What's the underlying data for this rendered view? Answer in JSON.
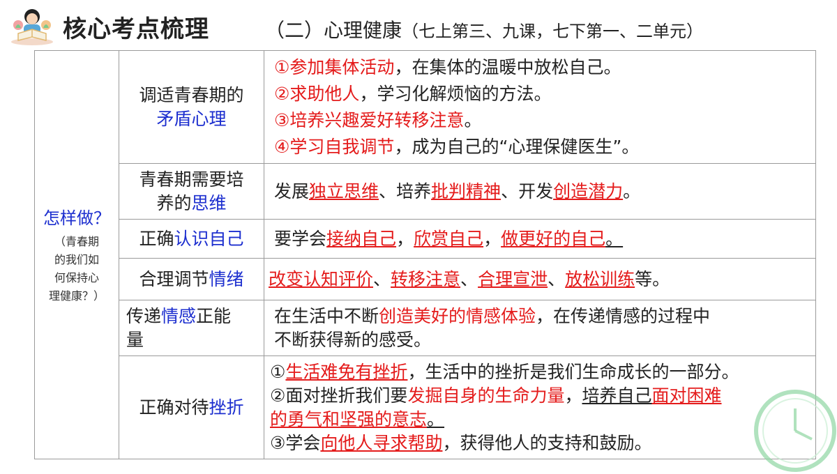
{
  "header": {
    "main_title": "核心考点梳理",
    "sub_title": "（二）心理健康",
    "sub_title_note": "（七上第三、九课，七下第一、二单元）"
  },
  "side": {
    "heading": "怎样做？",
    "note_lines": [
      "（青春期",
      "的我们如",
      "何保持心",
      "理健康？）"
    ]
  },
  "rows": [
    {
      "topic_a": "调适青春期的",
      "topic_b": "矛盾心理",
      "items": [
        {
          "num": "①",
          "key": "参加集体活动",
          "rest": "，在集体的温暖中放松自己。"
        },
        {
          "num": "②",
          "key": "求助他人",
          "rest": "，学习化解烦恼的方法。"
        },
        {
          "num": "③",
          "key": "培养兴趣爱好转移注意",
          "rest": "。"
        },
        {
          "num": "④",
          "key": "学习自我调节",
          "rest": "，成为自己的“心理保健医生”。"
        }
      ]
    },
    {
      "topic_a": "青春期需要培",
      "topic_b1": "养的",
      "topic_b2": "思维",
      "t1": "发展",
      "k1": "独立思维",
      "t2": "、培养",
      "k2": "批判精神",
      "t3": "、开发",
      "k3": "创造潜力",
      "t4": "。"
    },
    {
      "topic_a": "正确",
      "topic_b": "认识自己",
      "t1": "要学会",
      "k1": "接纳自己",
      "t2": "，",
      "k2": "欣赏自己",
      "t3": "，",
      "k3": "做更好的自己",
      "t4": "。"
    },
    {
      "topic_a": "合理调节",
      "topic_b": "情绪",
      "k1": "改变认知评价",
      "t1": "、",
      "k2": "转移注意",
      "t2": "、",
      "k3": "合理宣泄",
      "t3": "、",
      "k4": "放松训练",
      "t4": "等。"
    },
    {
      "topic_a": "传递",
      "topic_b": "情感",
      "topic_c": "正能",
      "topic_d": "量",
      "t1": "在生活中不断",
      "k1": "创造美好的情感体验",
      "t2": "，在传递情感的过程中",
      "t3": "不断获得新的感受。"
    },
    {
      "topic_a": "正确对待",
      "topic_b": "挫折",
      "l1_num": "①",
      "l1_key": "生活难免有挫折",
      "l1_rest": "，生活中的挫折是我们生命成长的一部分。",
      "l2_num": "②",
      "l2_t": "面对挫折我们要",
      "l2_key": "发掘自身的生命力量",
      "l2_t2": "，",
      "l2_t3": "培养自己",
      "l2_key2": "面对困难",
      "l3_key": "的勇气和坚强的意志",
      "l3_end": "。",
      "l4_num": "③",
      "l4_t": "学会",
      "l4_key": "向他人寻求帮助",
      "l4_rest": "，获得他人的支持和鼓励。"
    }
  ],
  "colors": {
    "accent_red": "#e41b1b",
    "accent_blue": "#1d2fcf",
    "border": "#9a9a9a"
  }
}
